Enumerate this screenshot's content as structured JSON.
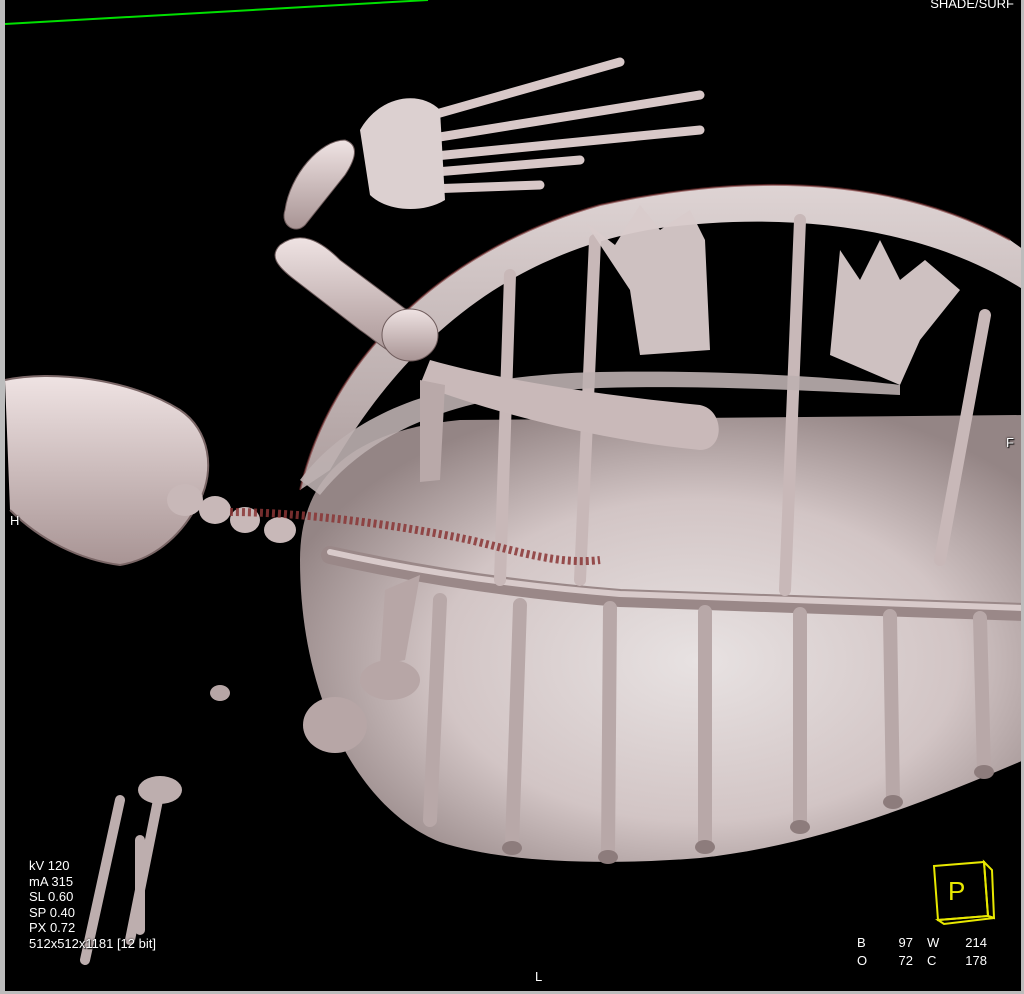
{
  "viewer": {
    "render_mode": "SHADE/SURF",
    "accent_line_color": "#00e000",
    "cube_color": "#e8e800"
  },
  "orientation": {
    "left_edge": "H",
    "right_edge": "F",
    "bottom_edge": "L",
    "cube_face": "P"
  },
  "acquisition": {
    "kv": "kV 120",
    "ma": "mA 315",
    "sl": "SL 0.60",
    "sp": "SP 0.40",
    "px": "PX 0.72",
    "matrix": "512x512x1181 [12 bit]"
  },
  "window_level": {
    "b_label": "B",
    "b_value": "97",
    "w_label": "W",
    "w_value": "214",
    "o_label": "O",
    "o_value": "72",
    "c_label": "C",
    "c_value": "178"
  }
}
